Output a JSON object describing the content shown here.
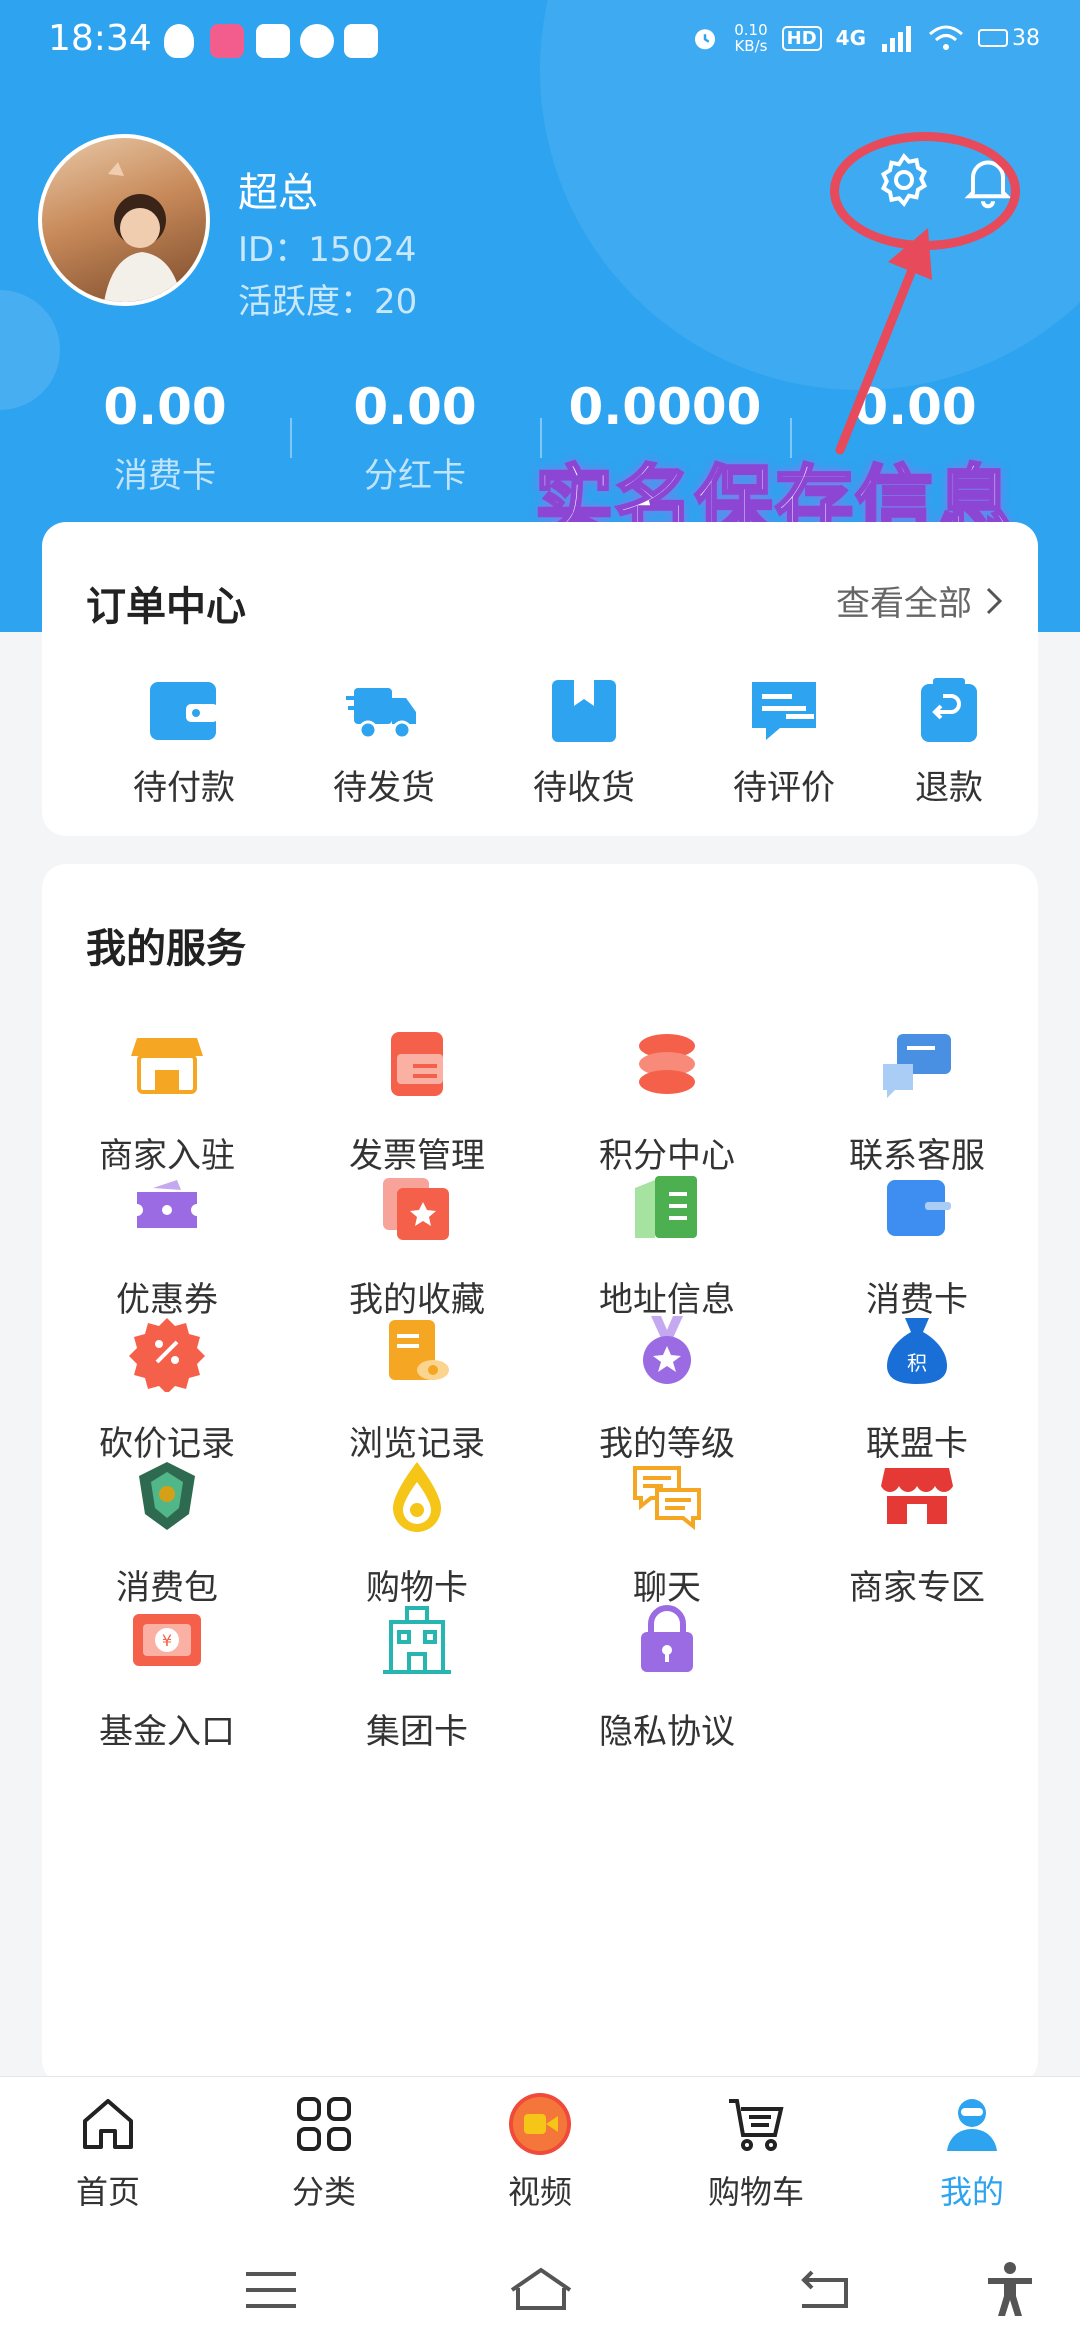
{
  "status_bar": {
    "time": "18:34",
    "net_speed_value": "0.10",
    "net_speed_unit": "KB/s",
    "hd_badge": "HD",
    "network": "4G",
    "battery": "38"
  },
  "profile": {
    "name": "超总",
    "id": "ID：15024",
    "activity": "活跃度：20"
  },
  "stats": [
    {
      "value": "0.00",
      "label": "消费卡"
    },
    {
      "value": "0.00",
      "label": "分红卡"
    },
    {
      "value": "0.0000",
      "label": ""
    },
    {
      "value": "0.00",
      "label": ""
    }
  ],
  "annotation": {
    "caption": "实名保存信息",
    "color": "#e74a5a"
  },
  "orders": {
    "title": "订单中心",
    "view_all": "查看全部",
    "items": [
      {
        "label": "待付款",
        "icon": "wallet-icon"
      },
      {
        "label": "待发货",
        "icon": "truck-icon"
      },
      {
        "label": "待收货",
        "icon": "package-icon"
      },
      {
        "label": "待评价",
        "icon": "comment-icon"
      },
      {
        "label": "退款",
        "icon": "refund-icon"
      }
    ]
  },
  "services": {
    "title": "我的服务",
    "items": [
      {
        "label": "商家入驻",
        "icon": "store-icon"
      },
      {
        "label": "发票管理",
        "icon": "invoice-icon"
      },
      {
        "label": "积分中心",
        "icon": "coins-icon"
      },
      {
        "label": "联系客服",
        "icon": "chat-icon"
      },
      {
        "label": "优惠券",
        "icon": "coupon-icon"
      },
      {
        "label": "我的收藏",
        "icon": "favorite-icon"
      },
      {
        "label": "地址信息",
        "icon": "address-book-icon"
      },
      {
        "label": "消费卡",
        "icon": "card-icon"
      },
      {
        "label": "砍价记录",
        "icon": "discount-icon"
      },
      {
        "label": "浏览记录",
        "icon": "history-icon"
      },
      {
        "label": "我的等级",
        "icon": "medal-icon"
      },
      {
        "label": "联盟卡",
        "icon": "money-bag-icon"
      },
      {
        "label": "消费包",
        "icon": "emblem-icon"
      },
      {
        "label": "购物卡",
        "icon": "drop-icon"
      },
      {
        "label": "聊天",
        "icon": "chat-bubbles-icon"
      },
      {
        "label": "商家专区",
        "icon": "shop-icon"
      },
      {
        "label": "基金入口",
        "icon": "fund-icon"
      },
      {
        "label": "集团卡",
        "icon": "building-icon"
      },
      {
        "label": "隐私协议",
        "icon": "lock-icon"
      }
    ]
  },
  "bottom_nav": [
    {
      "label": "首页",
      "icon": "home-icon"
    },
    {
      "label": "分类",
      "icon": "grid-icon"
    },
    {
      "label": "视频",
      "icon": "video-icon"
    },
    {
      "label": "购物车",
      "icon": "cart-icon"
    },
    {
      "label": "我的",
      "icon": "profile-icon",
      "active": true
    }
  ],
  "colors": {
    "primary": "#2ea3f0",
    "annotation": "#e74a5a",
    "caption_outline": "#8d46d4"
  }
}
